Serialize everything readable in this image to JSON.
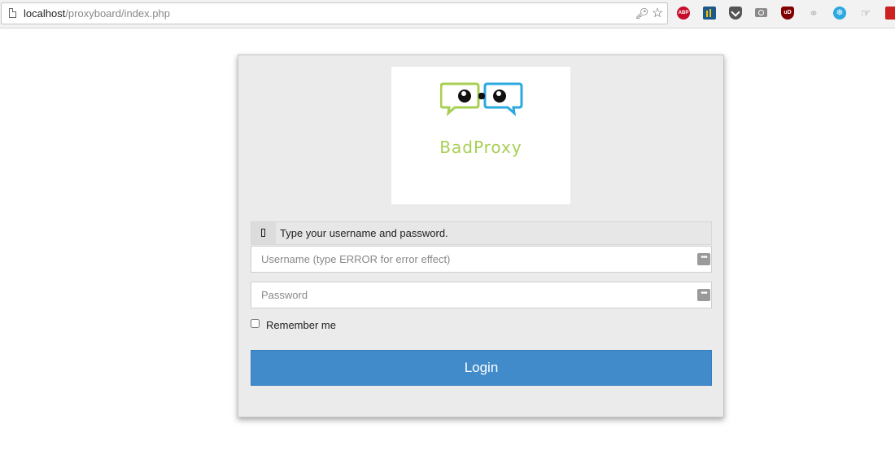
{
  "browser": {
    "url_host": "localhost",
    "url_path": "/proxyboard/index.php",
    "extensions": [
      "adblock-plus",
      "stats",
      "pocket",
      "screenshot",
      "ublock",
      "link",
      "snowflake",
      "hand",
      "red-extension"
    ],
    "abp_label": "ABP",
    "ublock_label": "uD"
  },
  "login": {
    "logo_text": "BadProxy",
    "message": "Type your username and password.",
    "username_placeholder": "Username (type ERROR for error effect)",
    "password_placeholder": "Password",
    "remember_label": "Remember me",
    "remember_checked": false,
    "login_label": "Login",
    "accent_color": "#428bca",
    "logo_green": "#a7cf53",
    "logo_blue": "#29a9e0"
  }
}
